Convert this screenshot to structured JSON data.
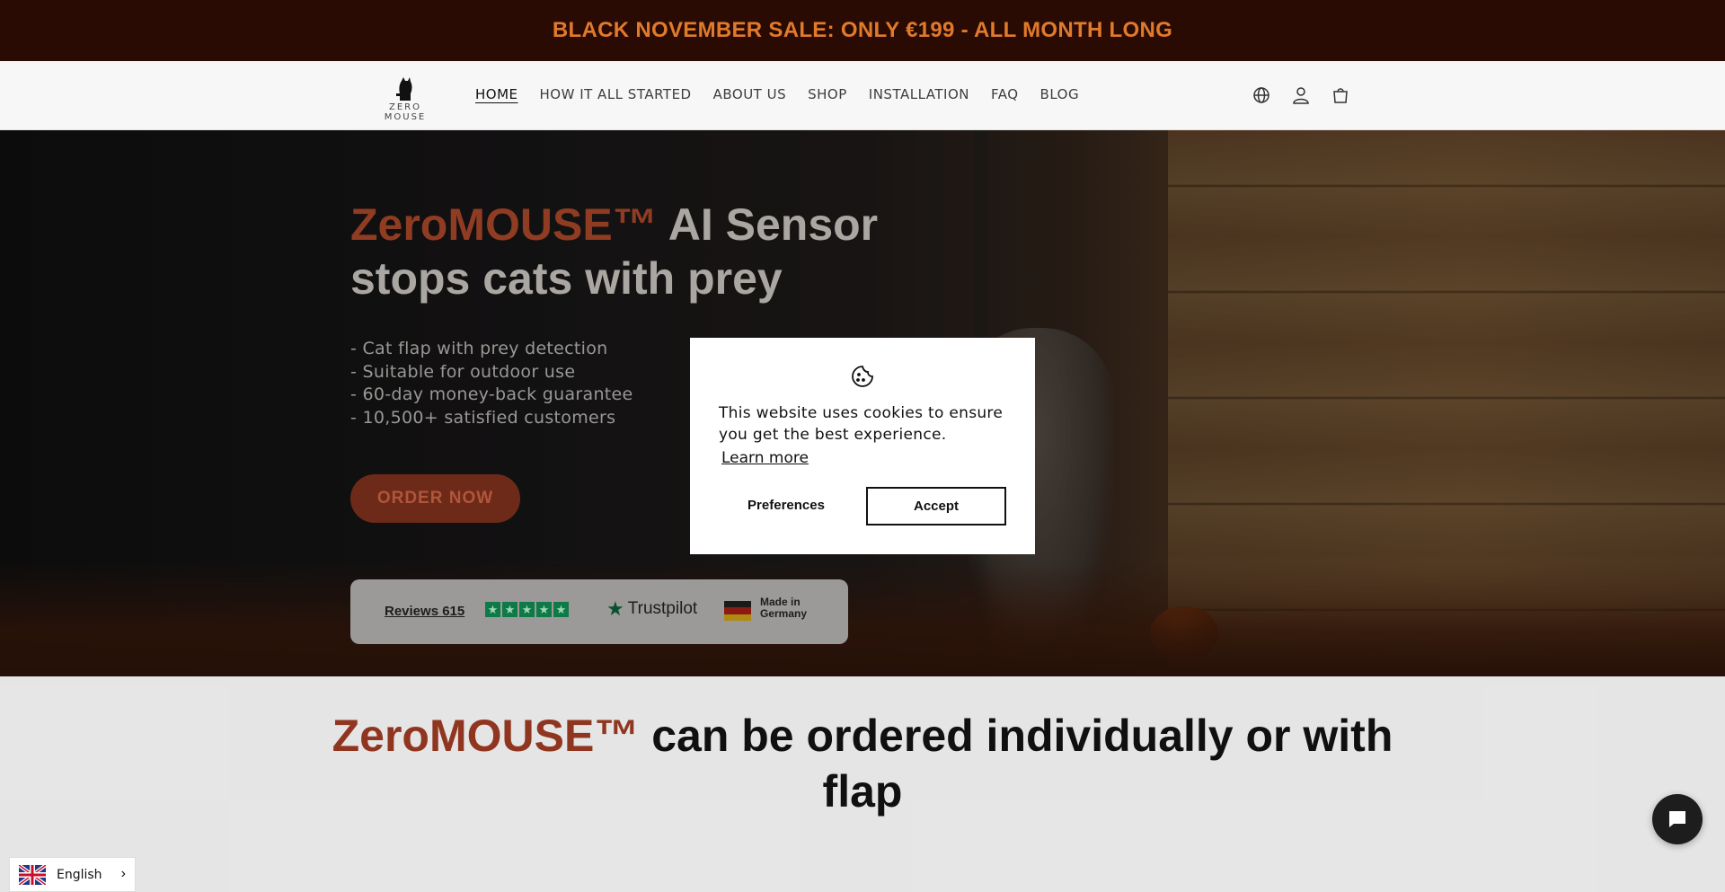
{
  "announcement": {
    "text": "BLACK NOVEMBER SALE: ONLY €199 - ALL MONTH LONG"
  },
  "header": {
    "logo_text": "ZERO MOUSE",
    "nav": [
      {
        "label": "HOME",
        "active": true
      },
      {
        "label": "HOW IT ALL STARTED"
      },
      {
        "label": "ABOUT US"
      },
      {
        "label": "SHOP"
      },
      {
        "label": "INSTALLATION"
      },
      {
        "label": "FAQ"
      },
      {
        "label": "BLOG"
      }
    ],
    "icons": [
      "globe-icon",
      "account-icon",
      "cart-icon"
    ]
  },
  "hero": {
    "title_brand": "ZeroMOUSE™",
    "title_rest": " AI Sensor stops cats with prey",
    "bullets": [
      "- Cat flap with prey detection",
      "- Suitable for outdoor use",
      "- 60-day money-back guarantee",
      "- 10,500+ satisfied customers"
    ],
    "cta": "ORDER NOW",
    "trust": {
      "reviews": "Reviews 615",
      "stars": 5,
      "trustpilot": "Trustpilot",
      "made_in_line1": "Made in",
      "made_in_line2": "Germany"
    }
  },
  "section": {
    "title_brand": "ZeroMOUSE™",
    "title_rest": " can be ordered individually or with flap"
  },
  "cookie_modal": {
    "message": "This website uses cookies to ensure you get the best experience.",
    "learn_more": "Learn more",
    "preferences": "Preferences",
    "accept": "Accept"
  },
  "language": {
    "selected": "English"
  },
  "colors": {
    "announce_bg": "#2a0b03",
    "announce_text": "#e07a2c",
    "brand": "#9a3a22",
    "trustpilot_green": "#0f7a48"
  }
}
